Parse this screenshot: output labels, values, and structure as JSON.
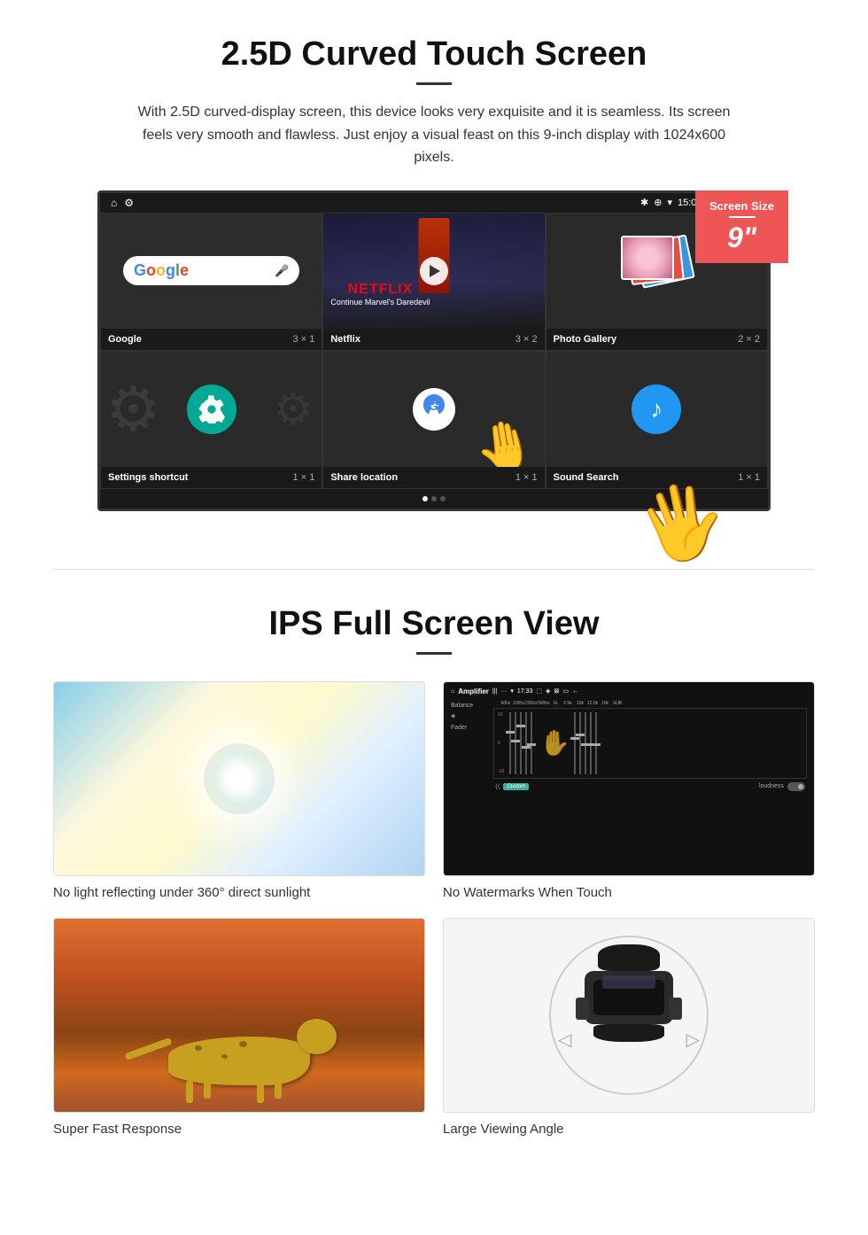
{
  "section1": {
    "title": "2.5D Curved Touch Screen",
    "description": "With 2.5D curved-display screen, this device looks very exquisite and it is seamless. Its screen feels very smooth and flawless. Just enjoy a visual feast on this 9-inch display with 1024x600 pixels.",
    "badge": {
      "label": "Screen Size",
      "size": "9\""
    },
    "status_bar": {
      "time": "15:06"
    },
    "apps": [
      {
        "name": "Google",
        "size": "3 × 1"
      },
      {
        "name": "Netflix",
        "size": "3 × 2"
      },
      {
        "name": "Photo Gallery",
        "size": "2 × 2"
      },
      {
        "name": "Settings shortcut",
        "size": "1 × 1"
      },
      {
        "name": "Share location",
        "size": "1 × 1"
      },
      {
        "name": "Sound Search",
        "size": "1 × 1"
      }
    ],
    "netflix_text": "NETFLIX",
    "netflix_sub": "Continue Marvel's Daredevil"
  },
  "section2": {
    "title": "IPS Full Screen View",
    "features": [
      {
        "label": "No light reflecting under 360° direct sunlight",
        "type": "sunlight"
      },
      {
        "label": "No Watermarks When Touch",
        "type": "watermark"
      },
      {
        "label": "Super Fast Response",
        "type": "cheetah"
      },
      {
        "label": "Large Viewing Angle",
        "type": "car"
      }
    ]
  }
}
